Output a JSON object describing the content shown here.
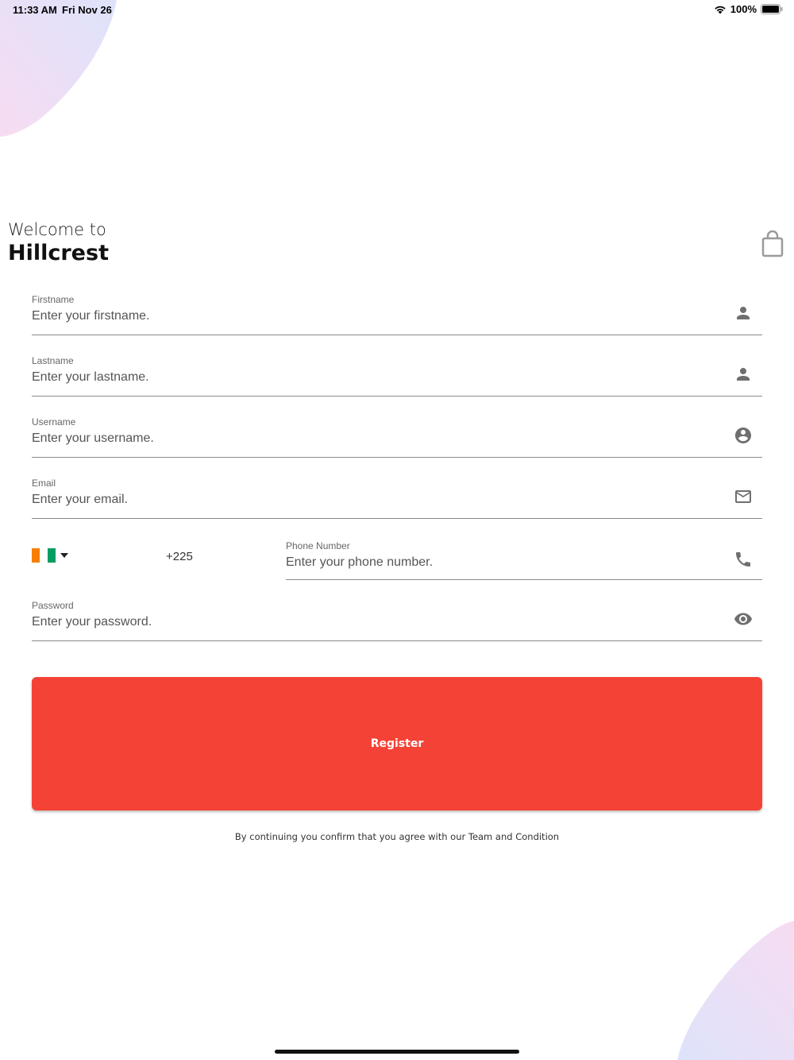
{
  "status_bar": {
    "time": "11:33 AM",
    "date": "Fri Nov 26",
    "battery": "100%"
  },
  "header": {
    "welcome": "Welcome to",
    "brand": "Hillcrest"
  },
  "form": {
    "firstname": {
      "label": "Firstname",
      "placeholder": "Enter your firstname.",
      "icon": "person-icon"
    },
    "lastname": {
      "label": "Lastname",
      "placeholder": "Enter your lastname.",
      "icon": "person-icon"
    },
    "username": {
      "label": "Username",
      "placeholder": "Enter your username.",
      "icon": "account-circle-icon"
    },
    "email": {
      "label": "Email",
      "placeholder": "Enter your email.",
      "icon": "mail-icon"
    },
    "phone": {
      "country_flag": "cote-divoire-flag",
      "dial_code": "+225",
      "label": "Phone Number",
      "placeholder": "Enter your phone number.",
      "icon": "phone-icon"
    },
    "password": {
      "label": "Password",
      "placeholder": "Enter your password.",
      "icon": "eye-icon"
    },
    "register_label": "Register",
    "terms": "By continuing you confirm that you agree with our Team and Condition"
  },
  "colors": {
    "accent": "#f44336",
    "flag_orange": "#f77f00",
    "flag_white": "#ffffff",
    "flag_green": "#009e60"
  }
}
